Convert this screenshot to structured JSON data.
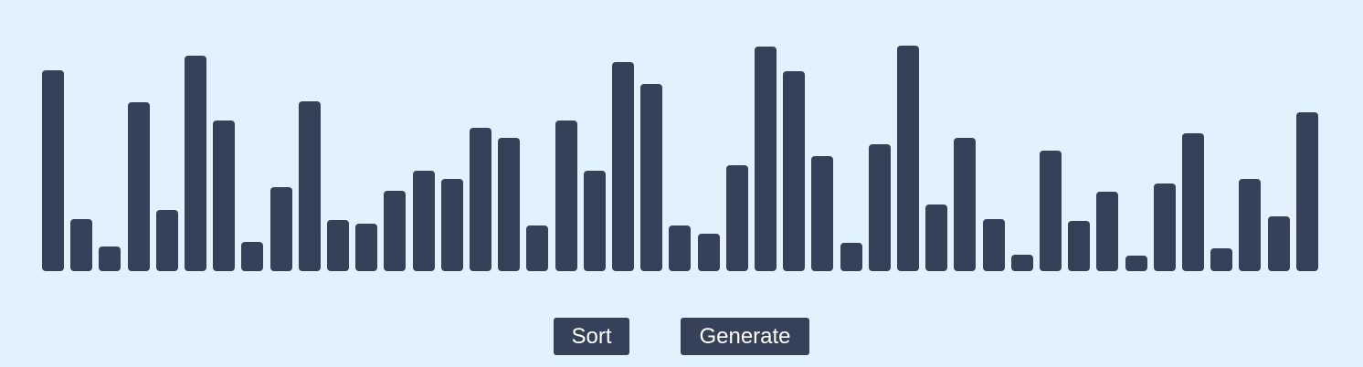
{
  "colors": {
    "background": "#e2f1fe",
    "bar": "#354158",
    "button": "#354158",
    "button_text": "#ffffff"
  },
  "controls": {
    "sort_label": "Sort",
    "generate_label": "Generate"
  },
  "chart_data": {
    "type": "bar",
    "title": "",
    "xlabel": "",
    "ylabel": "",
    "ylim": [
      0,
      250
    ],
    "values": [
      221,
      57,
      27,
      186,
      67,
      237,
      166,
      32,
      92,
      187,
      56,
      52,
      88,
      110,
      101,
      158,
      147,
      50,
      166,
      110,
      230,
      206,
      50,
      41,
      116,
      247,
      220,
      127,
      31,
      140,
      248,
      73,
      147,
      57,
      18,
      133,
      55,
      87,
      17,
      96,
      152,
      25,
      101,
      60,
      175
    ]
  }
}
